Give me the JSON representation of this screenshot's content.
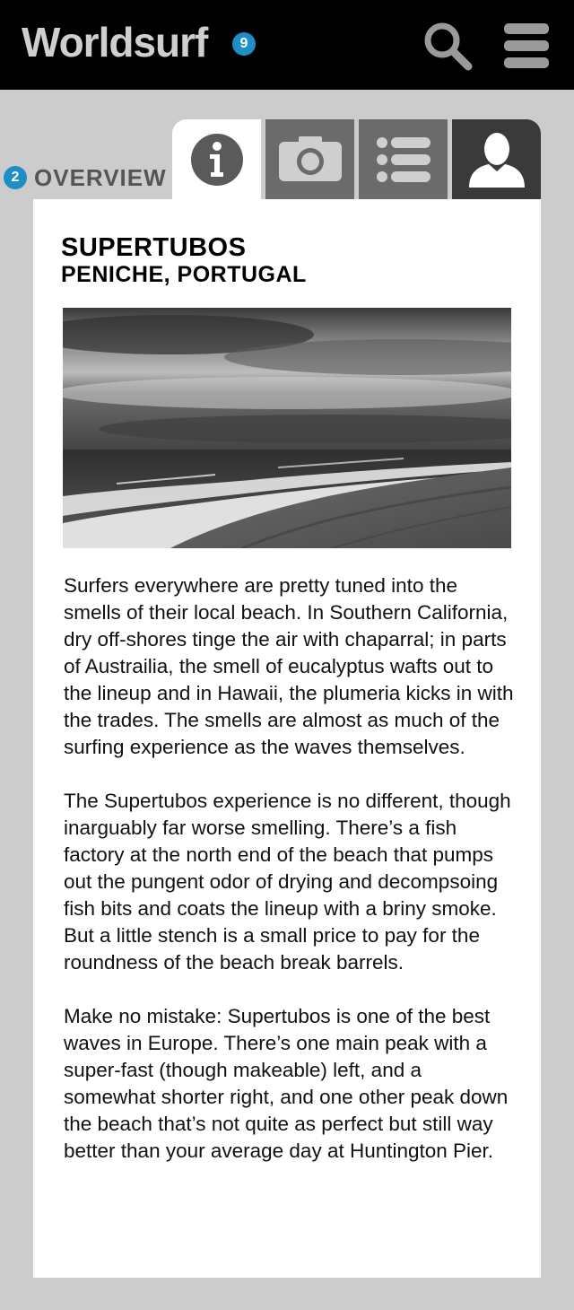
{
  "app": {
    "title": "Worldsurf",
    "notification_count": "9"
  },
  "header": {
    "search_icon": "search-icon",
    "menu_icon": "hamburger-menu-icon"
  },
  "section": {
    "step": "2",
    "label": "OVERVIEW"
  },
  "tabs": [
    {
      "icon": "info-icon",
      "selected": true
    },
    {
      "icon": "camera-icon",
      "selected": false
    },
    {
      "icon": "list-icon",
      "selected": false
    },
    {
      "icon": "user-icon",
      "selected": false
    }
  ],
  "spot": {
    "name": "SUPERTUBOS",
    "location": "PENICHE, PORTUGAL"
  },
  "body": {
    "paragraphs": [
      "Surfers everywhere are pretty tuned into the smells of their local beach. In Southern California, dry off-shores tinge the air with chaparral; in parts of Austrailia, the smell of eucalyptus wafts out to the lineup and in Hawaii, the plumeria kicks in with the trades. The smells are almost as much of the surfing experience as the waves themselves.",
      "The Supertubos experience is no different, though inarguably far worse smelling. There’s a fish factory at the north end of the beach that pumps out the pungent odor of drying and decompsoing fish bits and coats the lineup with a briny smoke. But a little stench is a small price to pay for the roundness of the beach break barrels.",
      "Make no mistake: Supertubos is one of the best waves in Europe. There’s one main peak with a super-fast (though makeable) left, and a somewhat shorter right, and one other peak down the beach that’s not quite as perfect but still way better than your average day at Huntington Pier."
    ]
  },
  "colors": {
    "header_bg": "#000000",
    "page_bg": "#cccccc",
    "badge": "#1e8fc6",
    "tab_inactive": "#6b6b6b",
    "tab_dark": "#3a3a3a"
  }
}
